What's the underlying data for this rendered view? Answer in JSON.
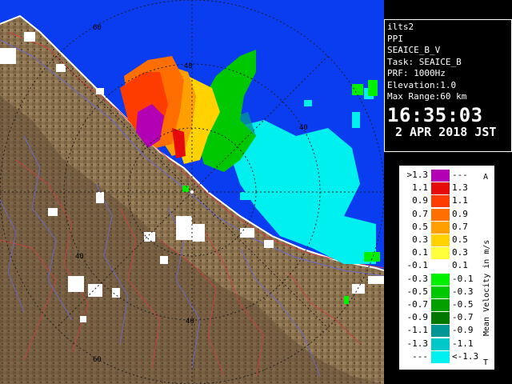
{
  "info": {
    "site": "ilts2",
    "mode": "PPI",
    "product": "SEAICE_B_V",
    "task": "Task: SEAICE_B",
    "prf": "PRF: 1000Hz",
    "elevation": "Elevation:1.0",
    "max_range": "Max Range:60 km",
    "time": "16:35:03",
    "date": "2 APR 2018 JST"
  },
  "range_labels": {
    "r60_top": "60",
    "r40_top": "40",
    "r40_right": "40",
    "r40_left": "40",
    "r40_bottom": "40",
    "r60_bottom": "60"
  },
  "legend": {
    "title": "Mean Velocity in m/s",
    "top_marker": "A",
    "bottom_marker": "T",
    "rows": [
      {
        "lo": ">1.3",
        "hi": "---",
        "color": "#b400b4"
      },
      {
        "lo": "1.1",
        "hi": "1.3",
        "color": "#e60a0a"
      },
      {
        "lo": "0.9",
        "hi": "1.1",
        "color": "#ff3c00"
      },
      {
        "lo": "0.7",
        "hi": "0.9",
        "color": "#ff6e00"
      },
      {
        "lo": "0.5",
        "hi": "0.7",
        "color": "#ffa000"
      },
      {
        "lo": "0.3",
        "hi": "0.5",
        "color": "#ffd200"
      },
      {
        "lo": "0.1",
        "hi": "0.3",
        "color": "#ffff3c"
      },
      {
        "lo": "-0.1",
        "hi": "0.1",
        "color": "#ffffff"
      },
      {
        "lo": "-0.3",
        "hi": "-0.1",
        "color": "#00f000"
      },
      {
        "lo": "-0.5",
        "hi": "-0.3",
        "color": "#00c800"
      },
      {
        "lo": "-0.7",
        "hi": "-0.5",
        "color": "#00a000"
      },
      {
        "lo": "-0.9",
        "hi": "-0.7",
        "color": "#007800"
      },
      {
        "lo": "-1.1",
        "hi": "-0.9",
        "color": "#009696"
      },
      {
        "lo": "-1.3",
        "hi": "-1.1",
        "color": "#00c8c8"
      },
      {
        "lo": "---",
        "hi": "<-1.3",
        "color": "#00f0f0"
      }
    ]
  },
  "colors": {
    "sea": "#0a3cf0",
    "land": "#8c7350",
    "land_dark": "#5a4630",
    "range_ring": "#1e1e1e",
    "coast": "#ffffff",
    "roads": "#d04040",
    "rivers": "#6a6ad0"
  }
}
